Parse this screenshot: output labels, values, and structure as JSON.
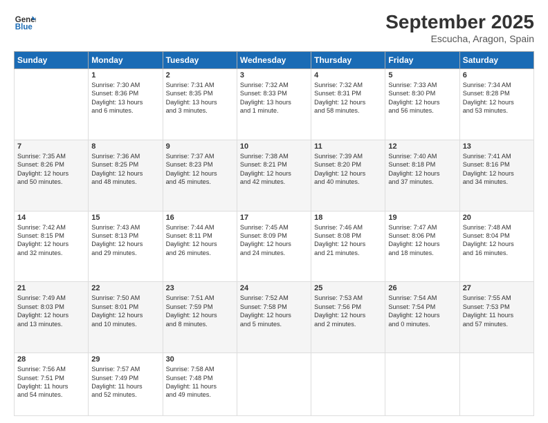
{
  "logo": {
    "general": "General",
    "blue": "Blue"
  },
  "title": "September 2025",
  "subtitle": "Escucha, Aragon, Spain",
  "days_header": [
    "Sunday",
    "Monday",
    "Tuesday",
    "Wednesday",
    "Thursday",
    "Friday",
    "Saturday"
  ],
  "weeks": [
    [
      {
        "day": "",
        "info": ""
      },
      {
        "day": "1",
        "info": "Sunrise: 7:30 AM\nSunset: 8:36 PM\nDaylight: 13 hours\nand 6 minutes."
      },
      {
        "day": "2",
        "info": "Sunrise: 7:31 AM\nSunset: 8:35 PM\nDaylight: 13 hours\nand 3 minutes."
      },
      {
        "day": "3",
        "info": "Sunrise: 7:32 AM\nSunset: 8:33 PM\nDaylight: 13 hours\nand 1 minute."
      },
      {
        "day": "4",
        "info": "Sunrise: 7:32 AM\nSunset: 8:31 PM\nDaylight: 12 hours\nand 58 minutes."
      },
      {
        "day": "5",
        "info": "Sunrise: 7:33 AM\nSunset: 8:30 PM\nDaylight: 12 hours\nand 56 minutes."
      },
      {
        "day": "6",
        "info": "Sunrise: 7:34 AM\nSunset: 8:28 PM\nDaylight: 12 hours\nand 53 minutes."
      }
    ],
    [
      {
        "day": "7",
        "info": "Sunrise: 7:35 AM\nSunset: 8:26 PM\nDaylight: 12 hours\nand 50 minutes."
      },
      {
        "day": "8",
        "info": "Sunrise: 7:36 AM\nSunset: 8:25 PM\nDaylight: 12 hours\nand 48 minutes."
      },
      {
        "day": "9",
        "info": "Sunrise: 7:37 AM\nSunset: 8:23 PM\nDaylight: 12 hours\nand 45 minutes."
      },
      {
        "day": "10",
        "info": "Sunrise: 7:38 AM\nSunset: 8:21 PM\nDaylight: 12 hours\nand 42 minutes."
      },
      {
        "day": "11",
        "info": "Sunrise: 7:39 AM\nSunset: 8:20 PM\nDaylight: 12 hours\nand 40 minutes."
      },
      {
        "day": "12",
        "info": "Sunrise: 7:40 AM\nSunset: 8:18 PM\nDaylight: 12 hours\nand 37 minutes."
      },
      {
        "day": "13",
        "info": "Sunrise: 7:41 AM\nSunset: 8:16 PM\nDaylight: 12 hours\nand 34 minutes."
      }
    ],
    [
      {
        "day": "14",
        "info": "Sunrise: 7:42 AM\nSunset: 8:15 PM\nDaylight: 12 hours\nand 32 minutes."
      },
      {
        "day": "15",
        "info": "Sunrise: 7:43 AM\nSunset: 8:13 PM\nDaylight: 12 hours\nand 29 minutes."
      },
      {
        "day": "16",
        "info": "Sunrise: 7:44 AM\nSunset: 8:11 PM\nDaylight: 12 hours\nand 26 minutes."
      },
      {
        "day": "17",
        "info": "Sunrise: 7:45 AM\nSunset: 8:09 PM\nDaylight: 12 hours\nand 24 minutes."
      },
      {
        "day": "18",
        "info": "Sunrise: 7:46 AM\nSunset: 8:08 PM\nDaylight: 12 hours\nand 21 minutes."
      },
      {
        "day": "19",
        "info": "Sunrise: 7:47 AM\nSunset: 8:06 PM\nDaylight: 12 hours\nand 18 minutes."
      },
      {
        "day": "20",
        "info": "Sunrise: 7:48 AM\nSunset: 8:04 PM\nDaylight: 12 hours\nand 16 minutes."
      }
    ],
    [
      {
        "day": "21",
        "info": "Sunrise: 7:49 AM\nSunset: 8:03 PM\nDaylight: 12 hours\nand 13 minutes."
      },
      {
        "day": "22",
        "info": "Sunrise: 7:50 AM\nSunset: 8:01 PM\nDaylight: 12 hours\nand 10 minutes."
      },
      {
        "day": "23",
        "info": "Sunrise: 7:51 AM\nSunset: 7:59 PM\nDaylight: 12 hours\nand 8 minutes."
      },
      {
        "day": "24",
        "info": "Sunrise: 7:52 AM\nSunset: 7:58 PM\nDaylight: 12 hours\nand 5 minutes."
      },
      {
        "day": "25",
        "info": "Sunrise: 7:53 AM\nSunset: 7:56 PM\nDaylight: 12 hours\nand 2 minutes."
      },
      {
        "day": "26",
        "info": "Sunrise: 7:54 AM\nSunset: 7:54 PM\nDaylight: 12 hours\nand 0 minutes."
      },
      {
        "day": "27",
        "info": "Sunrise: 7:55 AM\nSunset: 7:53 PM\nDaylight: 11 hours\nand 57 minutes."
      }
    ],
    [
      {
        "day": "28",
        "info": "Sunrise: 7:56 AM\nSunset: 7:51 PM\nDaylight: 11 hours\nand 54 minutes."
      },
      {
        "day": "29",
        "info": "Sunrise: 7:57 AM\nSunset: 7:49 PM\nDaylight: 11 hours\nand 52 minutes."
      },
      {
        "day": "30",
        "info": "Sunrise: 7:58 AM\nSunset: 7:48 PM\nDaylight: 11 hours\nand 49 minutes."
      },
      {
        "day": "",
        "info": ""
      },
      {
        "day": "",
        "info": ""
      },
      {
        "day": "",
        "info": ""
      },
      {
        "day": "",
        "info": ""
      }
    ]
  ]
}
